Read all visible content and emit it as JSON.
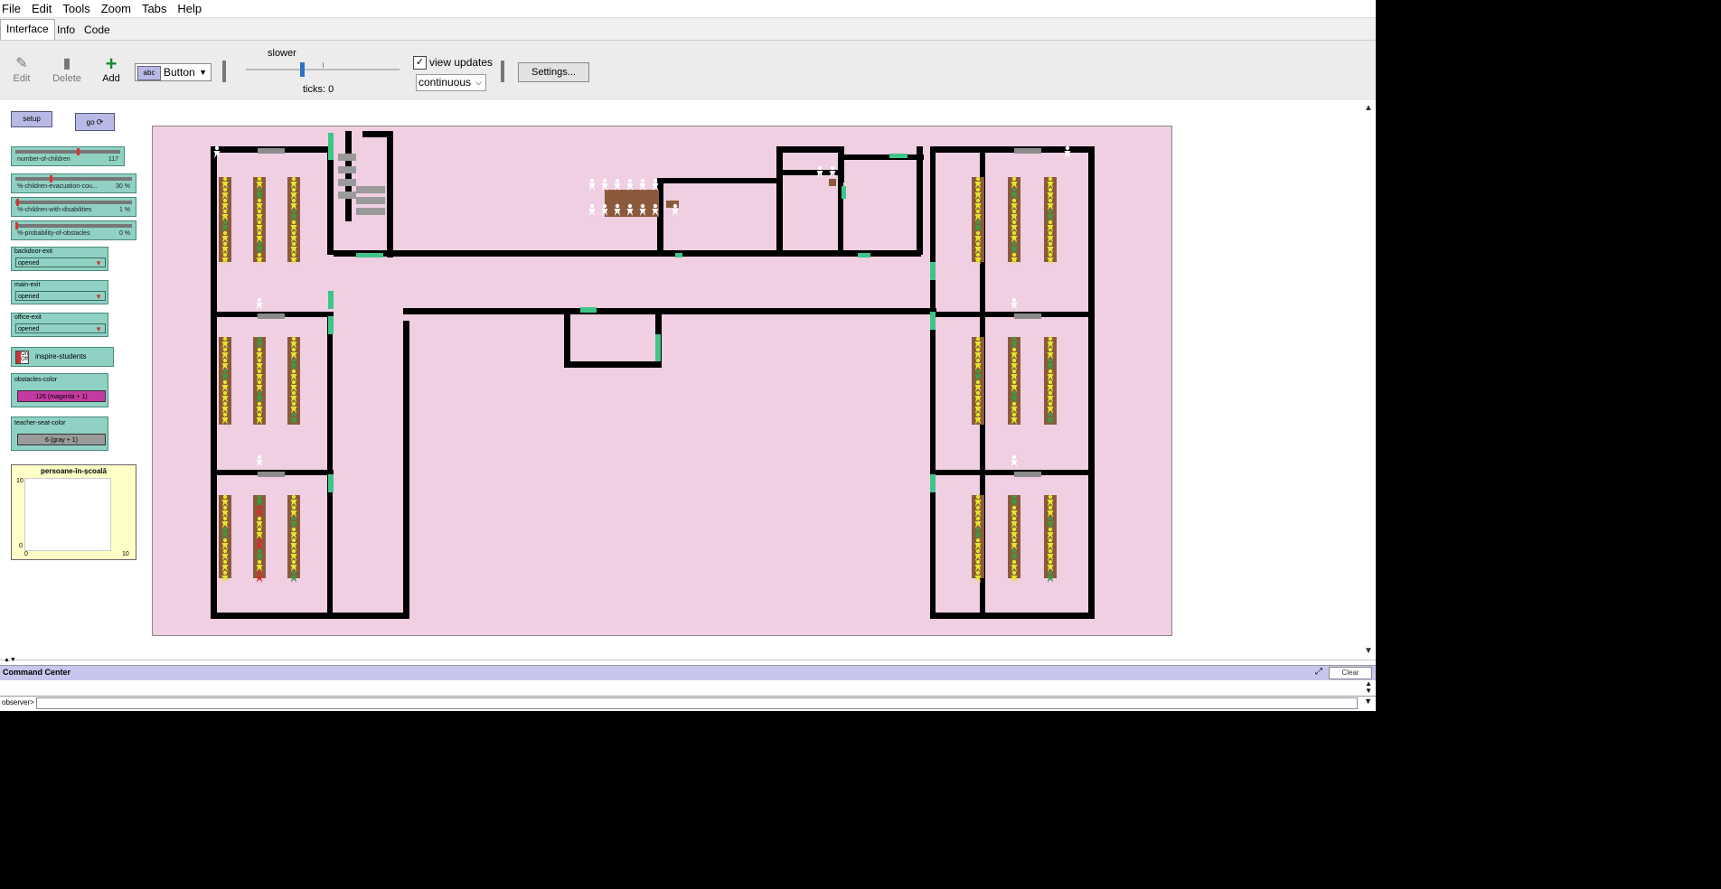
{
  "menu": [
    "File",
    "Edit",
    "Tools",
    "Zoom",
    "Tabs",
    "Help"
  ],
  "tabs": [
    "Interface",
    "Info",
    "Code"
  ],
  "toolbar": {
    "edit_label": "Edit",
    "delete_label": "Delete",
    "add_label": "Add",
    "widget_type": "Button",
    "widget_icon_text": "abc",
    "speed_label": "slower",
    "ticks_text": "ticks: 0",
    "view_updates_label": "view updates",
    "view_updates_checked": "✓",
    "update_mode": "continuous",
    "settings_label": "Settings..."
  },
  "widgets": {
    "setup_label": "setup",
    "go_label": "go",
    "sliders": [
      {
        "name": "number-of-children",
        "value": "117",
        "fraction": 0.6
      },
      {
        "name": "%-children-evacuation-cou...",
        "value": "30 %",
        "fraction": 0.3
      },
      {
        "name": "%-children-with-disabilities",
        "value": "1 %",
        "fraction": 0.01
      },
      {
        "name": "%-probability-of-obstacles",
        "value": "0 %",
        "fraction": 0.0
      }
    ],
    "choosers": [
      {
        "name": "backdoor-exit",
        "value": "opened"
      },
      {
        "name": "main-exit",
        "value": "opened"
      },
      {
        "name": "office-exit",
        "value": "opened"
      }
    ],
    "switch": {
      "name": "inspire-students",
      "on_label": "On",
      "off_label": "Off"
    },
    "inputs": [
      {
        "name": "obstacles-color",
        "value": "126 (magenta + 1)",
        "swatch": "#c33aa0"
      },
      {
        "name": "teacher-seat-color",
        "value": "6 (gray + 1)",
        "swatch": "#9a9a9a"
      }
    ],
    "plot": {
      "title": "persoane-în-școală",
      "y_max": "10",
      "y_min": "0",
      "x_min": "0",
      "x_max": "10"
    }
  },
  "world": {
    "background": "#efcfe1",
    "wall_color": "#000000",
    "exit_color": "#3ec68a",
    "desk_color": "#8b5a3c",
    "student_colors": [
      "#e6e62a",
      "#3f9a3f",
      "#d32f2f"
    ],
    "teacher_color": "#ffffff"
  },
  "command_center": {
    "title": "Command Center",
    "clear_label": "Clear",
    "prompt": "observer>"
  },
  "colors": {
    "button_bg": "#b9b9e6",
    "slider_bg": "#8fd1c3",
    "plot_bg": "#ffffc8",
    "cc_header": "#c7c7ee"
  }
}
